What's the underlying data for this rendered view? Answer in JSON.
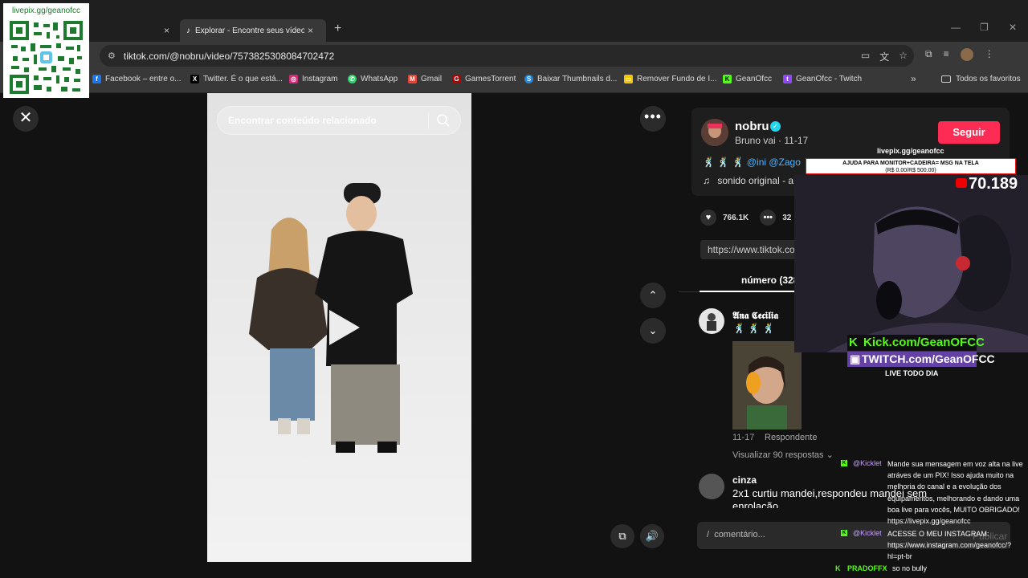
{
  "browser": {
    "tabs": [
      {
        "title": "",
        "close": "×"
      },
      {
        "title": "Explorar - Encontre seus vídeos",
        "close": "×"
      }
    ],
    "new_tab": "+",
    "url": "tiktok.com/@nobru/video/7573825308084702472",
    "bookmarks": [
      {
        "label": "Facebook – entre o...",
        "color": "#1877f2",
        "glyph": "f"
      },
      {
        "label": "Twitter. É o que está...",
        "color": "#000000",
        "glyph": "X"
      },
      {
        "label": "Instagram",
        "color": "#d62976",
        "glyph": "◎"
      },
      {
        "label": "WhatsApp",
        "color": "#25d366",
        "glyph": "✆"
      },
      {
        "label": "Gmail",
        "color": "#ea4335",
        "glyph": "M"
      },
      {
        "label": "GamesTorrent",
        "color": "#b00000",
        "glyph": "G"
      },
      {
        "label": "Baixar Thumbnails d...",
        "color": "#1e88e5",
        "glyph": "S"
      },
      {
        "label": "Remover Fundo de I...",
        "color": "#f5c400",
        "glyph": "▭"
      },
      {
        "label": "GeanOfcc",
        "color": "#53fc18",
        "glyph": "K"
      },
      {
        "label": "GeanOfcc - Twitch",
        "color": "#9146ff",
        "glyph": "t"
      }
    ],
    "all_bookmarks": "Todos os favoritos"
  },
  "qr": {
    "label": "livepix.gg/geanofcc"
  },
  "video": {
    "search_placeholder": "Encontrar conteúdo relacionado"
  },
  "author": {
    "name": "nobru",
    "subtitle": "Bruno vai · 11-17",
    "follow_label": "Seguir",
    "description": "@ini @Zago",
    "music": "sonido original - ar",
    "likes": "766.1K",
    "comments": "32",
    "link": "https://www.tiktok.co",
    "tab_label": "número (328"
  },
  "comments": [
    {
      "name": "𝕬𝖓𝖆 𝕮𝖊𝖈𝖎𝖑𝖎𝖆",
      "date": "11-17",
      "reply": "Respondente",
      "replies": "Visualizar 90 respostas"
    },
    {
      "name": "cinza",
      "text": "2x1 curtiu mandei,respondeu mandei sem enrolação"
    }
  ],
  "comment_box": {
    "placeholder": "comentário...",
    "prefix": "/",
    "publish": "Publicar"
  },
  "stream": {
    "livepix": "livepix.gg/geanofcc",
    "monitor_line1": "AJUDA PARA MONITOR+CADEIRA= MSG NA TELA",
    "monitor_line2": "(R$ 0.00/R$ 500.00)",
    "subscribers": "70.189",
    "kick": "Kick.com/GeanOFCC",
    "twitch": "TWITCH.com/GeanOFCC",
    "live_daily": "LIVE TODO DIA",
    "chat": [
      {
        "user": "@Kicklet",
        "msg": "Mande sua mensagem em voz alta na live atráves de um PIX! Isso ajuda muito na melhoria do canal e a evolução dos equipamentos, melhorando e dando uma boa live para vocês, MUITO OBRIGADO! https://livepix.gg/geanofcc"
      },
      {
        "user": "@Kicklet",
        "msg": "ACESSE O MEU INSTAGRAM: https://www.instagram.com/geanofcc/?hl=pt-br"
      }
    ],
    "bottom_user": "PRADOFFX",
    "bottom_msg": "so no bully"
  }
}
